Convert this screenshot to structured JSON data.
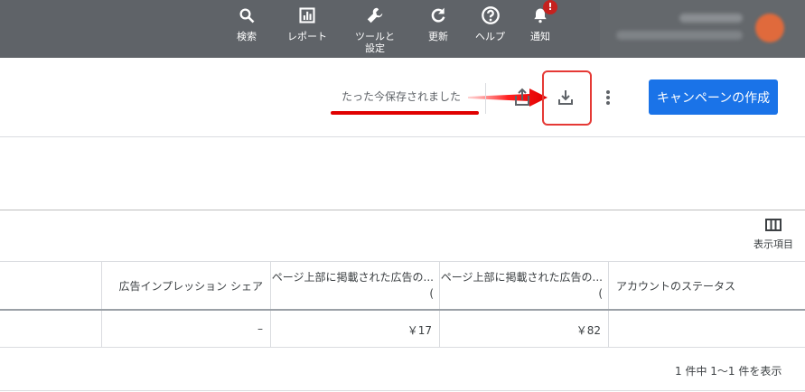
{
  "topnav": {
    "items": [
      {
        "label": "検索",
        "icon": "search-icon"
      },
      {
        "label": "レポート",
        "icon": "reports-icon"
      },
      {
        "label": "ツールと",
        "label2": "設定",
        "icon": "wrench-icon"
      },
      {
        "label": "更新",
        "icon": "refresh-icon"
      },
      {
        "label": "ヘルプ",
        "icon": "help-icon"
      },
      {
        "label": "通知",
        "icon": "bell-icon",
        "badge": "!"
      }
    ]
  },
  "toolbar": {
    "saved_status": "たった今保存されました",
    "create_button": "キャンペーンの作成"
  },
  "columns_button": {
    "label": "表示項目"
  },
  "table": {
    "headers": [
      "広告インプレッション シェア",
      "ページ上部に掲載された広告の...",
      "ページ上部に掲載された広告の...",
      "アカウントのステータス"
    ],
    "header_subs": [
      "",
      "(",
      "(",
      ""
    ],
    "row": [
      "–",
      "￥17",
      "￥82",
      ""
    ]
  },
  "pagination": "1 件中 1～1 件を表示",
  "colors": {
    "topbar": "#5f6368",
    "accent": "#1a73e8",
    "highlight": "#e53935"
  }
}
